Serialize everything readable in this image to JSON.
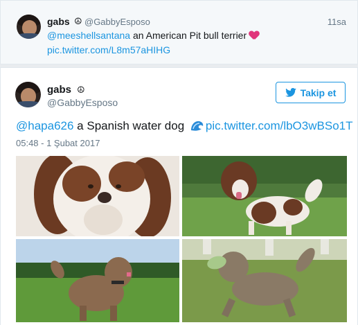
{
  "parent_tweet": {
    "name": "gabs",
    "peace_symbol": "☮",
    "handle": "@GabbyEsposo",
    "time": "11sa",
    "mention": "@meeshellsantana",
    "text": " an American Pit bull terrier",
    "link": "pic.twitter.com/L8m57aHIHG"
  },
  "main_tweet": {
    "name": "gabs",
    "peace_symbol": "☮",
    "handle": "@GabbyEsposo",
    "follow_label": "Takip et",
    "mention": "@hapa626",
    "text": " a Spanish water dog ",
    "link": "pic.twitter.com/lbO3wBSo1T",
    "timestamp": "05:48 - 1 Şubat 2017"
  },
  "colors": {
    "link": "#1b95e0",
    "secondary_text": "#657786",
    "heart": "#e0357b"
  },
  "icons": [
    "peace-icon",
    "heart-emoji-icon",
    "twitter-bird-icon",
    "wave-emoji-icon"
  ]
}
